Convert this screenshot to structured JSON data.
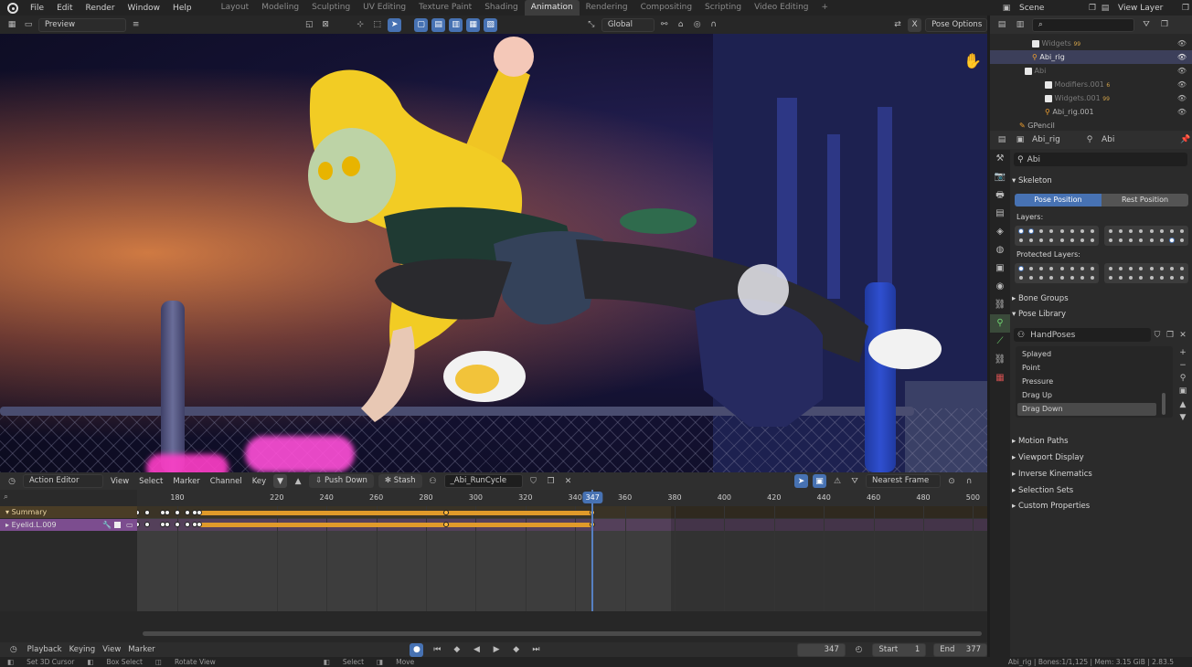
{
  "menu": {
    "items": [
      "File",
      "Edit",
      "Render",
      "Window",
      "Help"
    ]
  },
  "workspaces": [
    {
      "label": "Layout",
      "active": false
    },
    {
      "label": "Modeling",
      "active": false
    },
    {
      "label": "Sculpting",
      "active": false
    },
    {
      "label": "UV Editing",
      "active": false
    },
    {
      "label": "Texture Paint",
      "active": false
    },
    {
      "label": "Shading",
      "active": false
    },
    {
      "label": "Animation",
      "active": true
    },
    {
      "label": "Rendering",
      "active": false
    },
    {
      "label": "Compositing",
      "active": false
    },
    {
      "label": "Scripting",
      "active": false
    },
    {
      "label": "Video Editing",
      "active": false
    }
  ],
  "topbar": {
    "add_tab": "+",
    "scene": "Scene",
    "view_layer": "View Layer"
  },
  "viewport_header": {
    "mode": "Preview",
    "orientation": "Global",
    "pose_options": "Pose Options",
    "x_label": "X"
  },
  "dopesheet": {
    "menus": [
      "View",
      "Select",
      "Marker",
      "Channel",
      "Key"
    ],
    "editor_mode": "Action Editor",
    "push_down": "Push Down",
    "stash": "Stash",
    "action_name": "_Abi_RunCycle",
    "snap": "Nearest Frame",
    "channels": [
      {
        "label": "Summary"
      },
      {
        "label": "Eyelid.L.009"
      }
    ],
    "ruler_ticks": [
      "180",
      "220",
      "240",
      "260",
      "280",
      "300",
      "320",
      "340",
      "360",
      "380",
      "400",
      "420",
      "440",
      "460",
      "480",
      "500"
    ],
    "current_frame": "347"
  },
  "timeline": {
    "menus": [
      "Playback",
      "Keying",
      "View",
      "Marker"
    ],
    "frame": "347",
    "start_label": "Start",
    "start": "1",
    "end_label": "End",
    "end": "377"
  },
  "statusbar": {
    "items": [
      "Set 3D Cursor",
      "Box Select",
      "Rotate View",
      "Select",
      "Move"
    ],
    "info": "Abi_rig | Bones:1/1,125 | Mem: 3.15 GiB | 2.83.5"
  },
  "outliner": {
    "rows": [
      {
        "label": "Widgets",
        "badge": "99"
      },
      {
        "label": "Abi_rig",
        "badge": ""
      },
      {
        "label": "Abi",
        "badge": ""
      },
      {
        "label": "Modifiers.001",
        "badge": "6"
      },
      {
        "label": "Widgets.001",
        "badge": "99"
      },
      {
        "label": "Abi_rig.001",
        "badge": ""
      },
      {
        "label": "GPencil",
        "badge": ""
      }
    ]
  },
  "properties": {
    "breadcrumb_object": "Abi_rig",
    "breadcrumb_data": "Abi",
    "data_name": "Abi",
    "skeleton_title": "Skeleton",
    "pose_position": "Pose Position",
    "rest_position": "Rest Position",
    "layers_label": "Layers:",
    "protected_layers_label": "Protected Layers:",
    "bone_groups": "Bone Groups",
    "pose_library": "Pose Library",
    "library_name": "HandPoses",
    "poses": [
      {
        "label": "Splayed"
      },
      {
        "label": "Point"
      },
      {
        "label": "Pressure"
      },
      {
        "label": "Drag Up"
      },
      {
        "label": "Drag Down"
      }
    ],
    "panels": [
      "Motion Paths",
      "Viewport Display",
      "Inverse Kinematics",
      "Selection Sets",
      "Custom Properties"
    ]
  },
  "colors": {
    "accent": "#4772b3",
    "keyframe_selected": "#ffb73c",
    "action_row": "#7c4d8f"
  }
}
